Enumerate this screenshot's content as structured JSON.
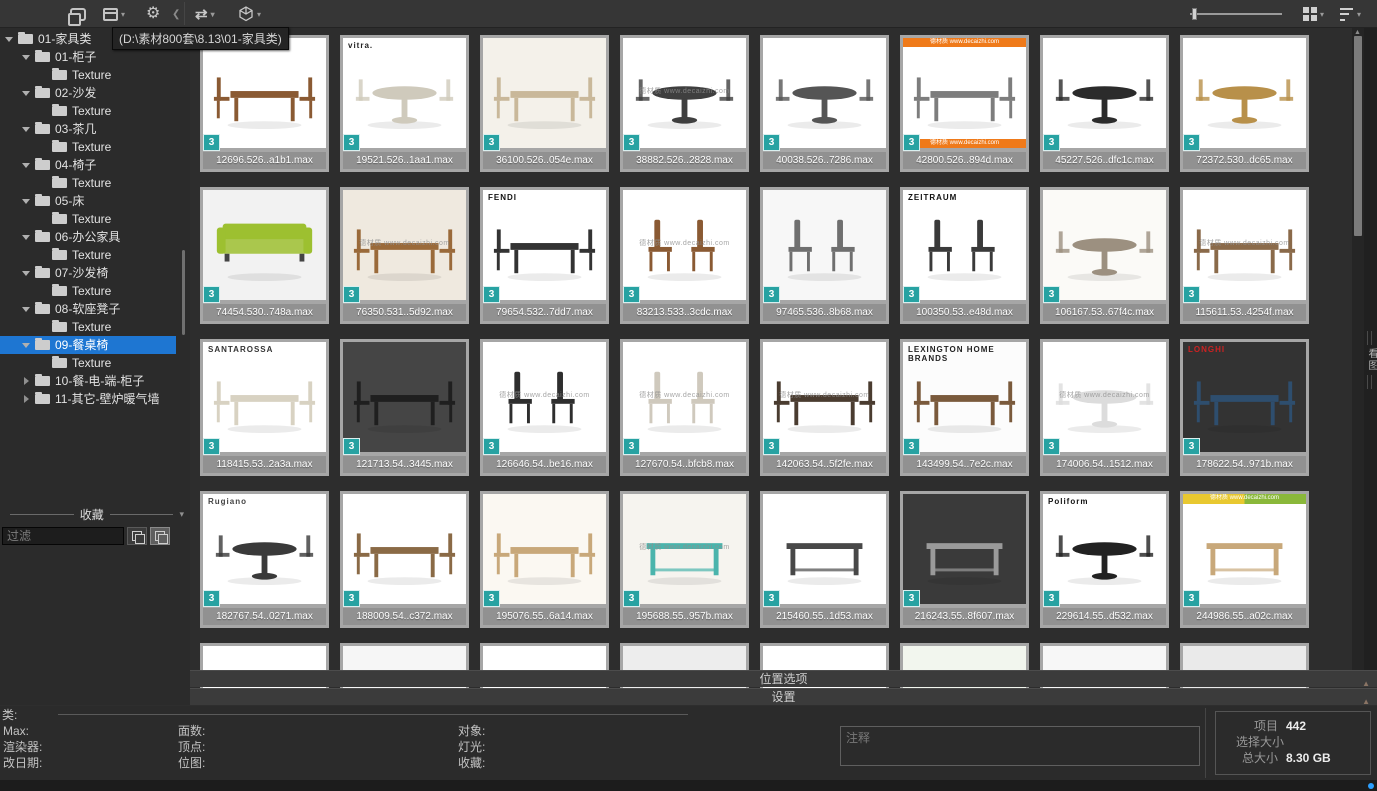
{
  "toolbar": {
    "icons_left": [
      "workspace-icon",
      "layout-panels-icon",
      "settings-gear-icon",
      "collapse-chevron-icon",
      "sync-icon",
      "export-cube-icon"
    ],
    "icons_right": [
      "thumbnail-size-slider",
      "grid-view-icon",
      "sort-icon"
    ],
    "tooltip": "(D:\\素材800套\\8.13\\01-家具类)"
  },
  "sidebar": {
    "fav_header": "收藏",
    "filter_placeholder": "过滤",
    "tree": [
      {
        "label": "01-家具类",
        "level": 0,
        "state": "exp",
        "selected": false
      },
      {
        "label": "01-柜子",
        "level": 1,
        "state": "exp",
        "selected": false
      },
      {
        "label": "Texture",
        "level": 2,
        "state": "leaf",
        "selected": false
      },
      {
        "label": "02-沙发",
        "level": 1,
        "state": "exp",
        "selected": false
      },
      {
        "label": "Texture",
        "level": 2,
        "state": "leaf",
        "selected": false
      },
      {
        "label": "03-茶几",
        "level": 1,
        "state": "exp",
        "selected": false
      },
      {
        "label": "Texture",
        "level": 2,
        "state": "leaf",
        "selected": false
      },
      {
        "label": "04-椅子",
        "level": 1,
        "state": "exp",
        "selected": false
      },
      {
        "label": "Texture",
        "level": 2,
        "state": "leaf",
        "selected": false
      },
      {
        "label": "05-床",
        "level": 1,
        "state": "exp",
        "selected": false
      },
      {
        "label": "Texture",
        "level": 2,
        "state": "leaf",
        "selected": false
      },
      {
        "label": "06-办公家具",
        "level": 1,
        "state": "exp",
        "selected": false
      },
      {
        "label": "Texture",
        "level": 2,
        "state": "leaf",
        "selected": false
      },
      {
        "label": "07-沙发椅",
        "level": 1,
        "state": "exp",
        "selected": false
      },
      {
        "label": "Texture",
        "level": 2,
        "state": "leaf",
        "selected": false
      },
      {
        "label": "08-软座凳子",
        "level": 1,
        "state": "exp",
        "selected": false
      },
      {
        "label": "Texture",
        "level": 2,
        "state": "leaf",
        "selected": false
      },
      {
        "label": "09-餐桌椅",
        "level": 1,
        "state": "exp",
        "selected": true
      },
      {
        "label": "Texture",
        "level": 2,
        "state": "leaf",
        "selected": false
      },
      {
        "label": "10-餐-电-端-柜子",
        "level": 1,
        "state": "col",
        "selected": false
      },
      {
        "label": "11-其它-壁炉暖气墙",
        "level": 1,
        "state": "col",
        "selected": false
      }
    ]
  },
  "grid": {
    "badge": "3",
    "watermark": "德材质 www.decaizhi.com",
    "rollouts": [
      "位置选项",
      "设置"
    ],
    "side_tab": "看图",
    "tiles": [
      {
        "name": "12696.526..a1b1.max",
        "shape": "rect",
        "bg": "#ffffff",
        "fur": "#8a5a33"
      },
      {
        "name": "19521.526..1aa1.max",
        "shape": "round",
        "bg": "#ffffff",
        "fur": "#cfcabc",
        "brand": "vitra.",
        "bc": "#222222"
      },
      {
        "name": "36100.526..054e.max",
        "shape": "rect",
        "bg": "#f4f1ea",
        "fur": "#c9b89a"
      },
      {
        "name": "38882.526..2828.max",
        "shape": "round",
        "bg": "#ffffff",
        "fur": "#3f3f3f",
        "wm": true
      },
      {
        "name": "40038.526..7286.max",
        "shape": "round",
        "bg": "#ffffff",
        "fur": "#555555"
      },
      {
        "name": "42800.526..894d.max",
        "shape": "rect",
        "bg": "#ffffff",
        "fur": "#7d7d7d",
        "banner": "orange"
      },
      {
        "name": "45227.526..dfc1c.max",
        "shape": "round",
        "bg": "#ffffff",
        "fur": "#2b2b2b"
      },
      {
        "name": "72372.530..dc65.max",
        "shape": "round",
        "bg": "#ffffff",
        "fur": "#b8904a"
      },
      {
        "name": "74454.530..748a.max",
        "shape": "sofa",
        "bg": "#f2f2f2",
        "fur": "#9dc030"
      },
      {
        "name": "76350.531..5d92.max",
        "shape": "rect",
        "bg": "#efe9df",
        "fur": "#9a6a3a",
        "wm": true
      },
      {
        "name": "79654.532..7dd7.max",
        "shape": "rect",
        "bg": "#ffffff",
        "fur": "#333333",
        "brand": "FENDI",
        "bc": "#111111"
      },
      {
        "name": "83213.533..3cdc.max",
        "shape": "chairs",
        "bg": "#ffffff",
        "fur": "#8a5a33",
        "wm": true
      },
      {
        "name": "97465.536..8b68.max",
        "shape": "chairs",
        "bg": "#f7f7f7",
        "fur": "#6f6f6f"
      },
      {
        "name": "100350.53..e48d.max",
        "shape": "chairs",
        "bg": "#ffffff",
        "fur": "#3a3a3a",
        "brand": "ZEITRAUM",
        "bc": "#111111"
      },
      {
        "name": "106167.53..67f4c.max",
        "shape": "round",
        "bg": "#fbfaf7",
        "fur": "#9c9080"
      },
      {
        "name": "115611.53..4254f.max",
        "shape": "rect",
        "bg": "#ffffff",
        "fur": "#8a6a4a",
        "wm": true
      },
      {
        "name": "118415.53..2a3a.max",
        "shape": "rect",
        "bg": "#ffffff",
        "fur": "#d8d2c2",
        "brand": "SANTAROSSA",
        "bc": "#333333"
      },
      {
        "name": "121713.54..3445.max",
        "shape": "rect",
        "bg": "#454545",
        "fur": "#1f1f1f"
      },
      {
        "name": "126646.54..be16.max",
        "shape": "chairs",
        "bg": "#ffffff",
        "fur": "#2e2e2e",
        "wm": true
      },
      {
        "name": "127670.54..bfcb8.max",
        "shape": "chairs",
        "bg": "#ffffff",
        "fur": "#cfc9bd",
        "wm": true
      },
      {
        "name": "142063.54..5f2fe.max",
        "shape": "rect",
        "bg": "#ffffff",
        "fur": "#4a3c30",
        "wm": true
      },
      {
        "name": "143499.54..7e2c.max",
        "shape": "rect",
        "bg": "#fcfcfc",
        "fur": "#7a5a3c",
        "brand": "LEXINGTON HOME BRANDS",
        "bc": "#222222"
      },
      {
        "name": "174006.54..1512.max",
        "shape": "round",
        "bg": "#ffffff",
        "fur": "#dcdcdc",
        "wm": true
      },
      {
        "name": "178622.54..971b.max",
        "shape": "rect",
        "bg": "#333333",
        "fur": "#2e4e6e",
        "brand": "LONGHI",
        "bc": "#cc2222"
      },
      {
        "name": "182767.54..0271.max",
        "shape": "round",
        "bg": "#ffffff",
        "fur": "#3a3a3a",
        "brand": "Rugiano",
        "bc": "#444444"
      },
      {
        "name": "188009.54..c372.max",
        "shape": "rect",
        "bg": "#ffffff",
        "fur": "#8a6a46"
      },
      {
        "name": "195076.55..6a14.max",
        "shape": "rect",
        "bg": "#fbf8f2",
        "fur": "#c8a87a"
      },
      {
        "name": "195688.55..957b.max",
        "shape": "desk",
        "bg": "#f6f4ef",
        "fur": "#4ab4ac",
        "wm": true
      },
      {
        "name": "215460.55..1d53.max",
        "shape": "desk",
        "bg": "#ffffff",
        "fur": "#484848"
      },
      {
        "name": "216243.55..8f607.max",
        "shape": "desk",
        "bg": "#3a3a3a",
        "fur": "#9a9a9a"
      },
      {
        "name": "229614.55..d532.max",
        "shape": "round",
        "bg": "#ffffff",
        "fur": "#222222",
        "brand": "Poliform",
        "bc": "#111111"
      },
      {
        "name": "244986.55..a02c.max",
        "shape": "desk",
        "bg": "#ffffff",
        "fur": "#c8a87a",
        "banner": "color"
      }
    ],
    "partials": [
      "#ffffff",
      "#f6f6f6",
      "#ffffff",
      "#ededed",
      "#ffffff",
      "#f2f6ee",
      "#f7f7f7",
      "#eaeaea"
    ]
  },
  "status": {
    "category_label": "类:",
    "col1": [
      "Max:",
      "渲染器:",
      "改日期:"
    ],
    "col2": [
      "面数:",
      "顶点:",
      "位图:"
    ],
    "col3": [
      "对象:",
      "灯光:",
      "收藏:"
    ],
    "comment_placeholder": "注释",
    "items_label": "项目",
    "items_value": "442",
    "selected_label": "选择大小",
    "selected_value": "",
    "total_label": "总大小",
    "total_value": "8.30 GB"
  }
}
